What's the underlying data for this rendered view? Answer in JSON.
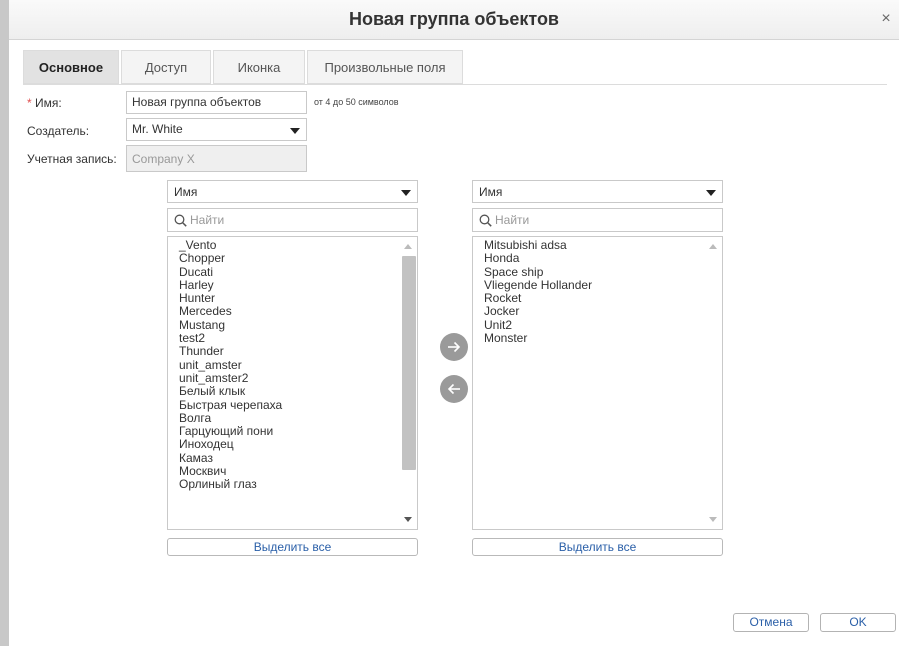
{
  "dialog": {
    "title": "Новая группа объектов",
    "close_glyph": "×"
  },
  "tabs": [
    {
      "label": "Основное",
      "active": true
    },
    {
      "label": "Доступ",
      "active": false
    },
    {
      "label": "Иконка",
      "active": false
    },
    {
      "label": "Произвольные поля",
      "active": false
    }
  ],
  "form": {
    "required_mark": "*",
    "name_label": "Имя:",
    "name_value": "Новая группа объектов",
    "name_hint": "от 4 до 50 символов",
    "creator_label": "Создатель:",
    "creator_value": "Mr. White",
    "account_label": "Учетная запись:",
    "account_value": "Company X"
  },
  "left_panel": {
    "sort_value": "Имя",
    "search_placeholder": "Найти",
    "items": [
      "_Vento",
      "Chopper",
      "Ducati",
      "Harley",
      "Hunter",
      "Mercedes",
      "Mustang",
      "test2",
      "Thunder",
      "unit_amster",
      "unit_amster2",
      "Белый клык",
      "Быстрая черепаха",
      "Волга",
      "Гарцующий пони",
      "Иноходец",
      "Камаз",
      "Москвич",
      "Орлиный глаз"
    ],
    "select_all_label": "Выделить все"
  },
  "right_panel": {
    "sort_value": "Имя",
    "search_placeholder": "Найти",
    "items": [
      "Mitsubishi adsa",
      "Honda",
      "Space ship",
      "Vliegende Hollander",
      "Rocket",
      "Jocker",
      "Unit2",
      "Monster"
    ],
    "select_all_label": "Выделить все"
  },
  "icons": {
    "move_right": "arrow-right-icon",
    "move_left": "arrow-left-icon",
    "search": "search-icon"
  },
  "colors": {
    "link_blue": "#2a5fa8",
    "move_button_gray": "#9a9a9a",
    "required_red": "#e05050"
  },
  "footer": {
    "cancel_label": "Отмена",
    "ok_label": "OK"
  }
}
